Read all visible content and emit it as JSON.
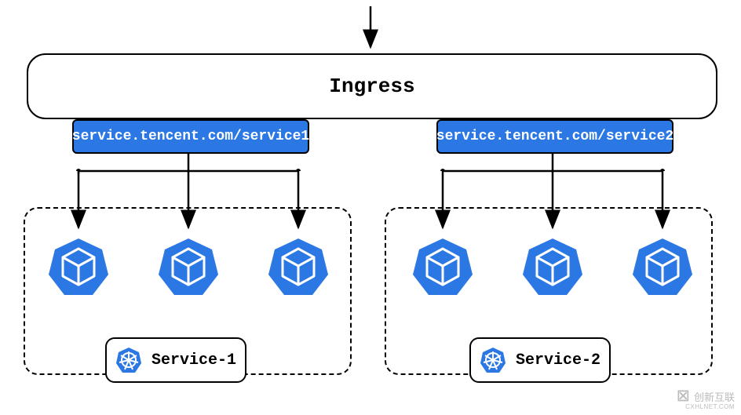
{
  "ingress": {
    "label": "Ingress"
  },
  "routes": {
    "r1": "service.tencent.com/service1",
    "r2": "service.tencent.com/service2"
  },
  "services": {
    "s1": "Service-1",
    "s2": "Service-2"
  },
  "icons": {
    "pod": "kubernetes-pod-cube",
    "wheel": "kubernetes-wheel"
  },
  "watermark": {
    "text": "创新互联",
    "sub": "CXHLNET.COM"
  }
}
